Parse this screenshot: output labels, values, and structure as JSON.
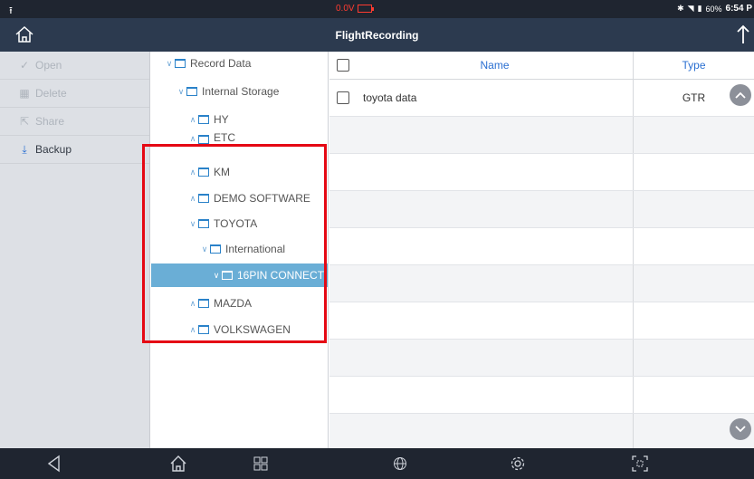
{
  "status": {
    "voltage": "0.0V",
    "battery": "60%",
    "time": "6:54 P"
  },
  "header": {
    "title": "FlightRecording"
  },
  "menu": [
    {
      "label": "Open",
      "icon": "check-icon",
      "enabled": false
    },
    {
      "label": "Delete",
      "icon": "trash-icon",
      "enabled": false
    },
    {
      "label": "Share",
      "icon": "share-icon",
      "enabled": false
    },
    {
      "label": "Backup",
      "icon": "download-icon",
      "enabled": true
    }
  ],
  "tree": [
    {
      "label": "Record Data",
      "level": 0,
      "expanded": true
    },
    {
      "label": "Internal Storage",
      "level": 1,
      "expanded": true
    },
    {
      "label": "HY",
      "level": 2,
      "expanded": false
    },
    {
      "label": "ETC",
      "level": 2,
      "expanded": false
    },
    {
      "label": "KM",
      "level": 2,
      "expanded": false
    },
    {
      "label": "DEMO SOFTWARE",
      "level": 2,
      "expanded": false
    },
    {
      "label": "TOYOTA",
      "level": 2,
      "expanded": true
    },
    {
      "label": "International",
      "level": 3,
      "expanded": true
    },
    {
      "label": "16PIN CONNECT",
      "level": 4,
      "expanded": true,
      "selected": true
    },
    {
      "label": "MAZDA",
      "level": 2,
      "expanded": false
    },
    {
      "label": "VOLKSWAGEN",
      "level": 2,
      "expanded": false
    }
  ],
  "table": {
    "columns": {
      "name": "Name",
      "type": "Type"
    },
    "rows": [
      {
        "name": "toyota data",
        "type": "GTR"
      }
    ]
  },
  "colors": {
    "accent": "#2a6fd1",
    "highlight": "#e50914",
    "selected": "#6aaed6"
  }
}
